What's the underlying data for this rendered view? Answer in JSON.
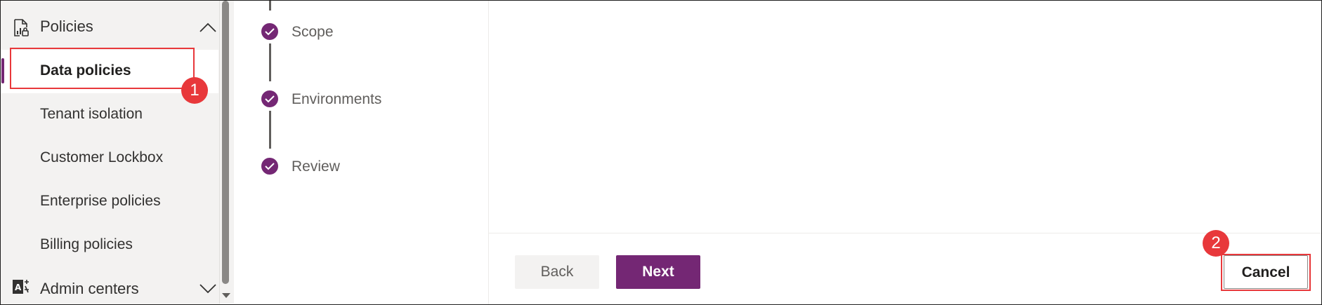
{
  "sidebar": {
    "group": {
      "label": "Policies",
      "icon": "policy-report-icon",
      "expanded": true
    },
    "items": [
      {
        "label": "Data policies",
        "active": true
      },
      {
        "label": "Tenant isolation"
      },
      {
        "label": "Customer Lockbox"
      },
      {
        "label": "Enterprise policies"
      },
      {
        "label": "Billing policies"
      }
    ],
    "next_group": {
      "label": "Admin centers",
      "icon": "admin-centers-icon",
      "expanded": false
    }
  },
  "stepper": {
    "steps": [
      {
        "label": "Scope",
        "state": "completed"
      },
      {
        "label": "Environments",
        "state": "completed"
      },
      {
        "label": "Review",
        "state": "completed"
      }
    ]
  },
  "footer": {
    "back_label": "Back",
    "next_label": "Next",
    "cancel_label": "Cancel"
  },
  "annotations": {
    "badge1": "1",
    "badge2": "2"
  },
  "colors": {
    "accent": "#742774",
    "callout": "#e8383b",
    "sidebar_bg": "#f3f2f1"
  }
}
